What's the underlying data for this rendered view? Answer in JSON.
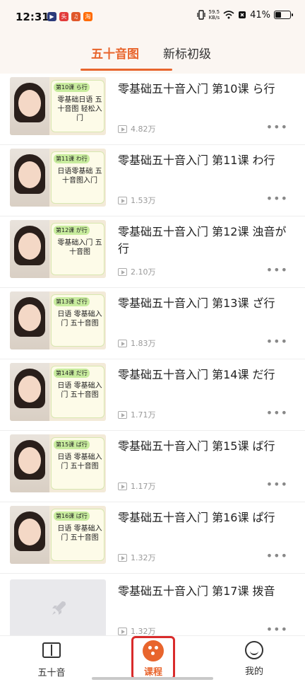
{
  "status_bar": {
    "time": "12:31",
    "apps": [
      {
        "name": "video-app-icon",
        "glyph": "▶",
        "color": "#2b3a7a"
      },
      {
        "name": "news-app-icon",
        "glyph": "头",
        "color": "#e23b3b"
      },
      {
        "name": "music-app-icon",
        "glyph": "♫",
        "color": "#e0572a"
      },
      {
        "name": "shop-app-icon",
        "glyph": "淘",
        "color": "#ff6a00"
      }
    ],
    "net_speed_value": "59.5",
    "net_speed_unit": "KB/s",
    "battery_percent": "41%"
  },
  "header": {
    "tabs": [
      {
        "label": "五十音图",
        "active": true
      },
      {
        "label": "新标初级",
        "active": false
      }
    ]
  },
  "lessons": [
    {
      "title": "零基础五十音入门 第10课 ら行",
      "views": "4.82万",
      "thumb_tag": "第10课 ら行",
      "thumb_text": "零基础日语 五十音图 轻松入门"
    },
    {
      "title": "零基础五十音入门 第11课 わ行",
      "views": "1.53万",
      "thumb_tag": "第11课 わ行",
      "thumb_text": "日语零基础 五十音图入门"
    },
    {
      "title": "零基础五十音入门 第12课 浊音が行",
      "views": "2.10万",
      "thumb_tag": "第12课 が行",
      "thumb_text": "零基础入门 五十音图"
    },
    {
      "title": "零基础五十音入门 第13课 ざ行",
      "views": "1.83万",
      "thumb_tag": "第13课 ざ行",
      "thumb_text": "日语 零基础入门 五十音图"
    },
    {
      "title": "零基础五十音入门 第14课 だ行",
      "views": "1.71万",
      "thumb_tag": "第14课 だ行",
      "thumb_text": "日语 零基础入门 五十音图"
    },
    {
      "title": "零基础五十音入门 第15课 ば行",
      "views": "1.17万",
      "thumb_tag": "第15课 ば行",
      "thumb_text": "日语 零基础入门 五十音图"
    },
    {
      "title": "零基础五十音入门 第16课 ぱ行",
      "views": "1.32万",
      "thumb_tag": "第16课 ぱ行",
      "thumb_text": "日语 零基础入门 五十音图"
    },
    {
      "title": "零基础五十音入门 第17课 拨音",
      "views": "1.32万",
      "thumb_tag": "",
      "thumb_text": ""
    }
  ],
  "more_glyph": "•••",
  "bottom_nav": [
    {
      "label": "五十音",
      "icon": "book-icon",
      "active": false
    },
    {
      "label": "课程",
      "icon": "course-icon",
      "active": true
    },
    {
      "label": "我的",
      "icon": "smile-face-icon",
      "active": false
    }
  ],
  "colors": {
    "accent": "#e8652d",
    "highlight": "#d92b2b"
  }
}
